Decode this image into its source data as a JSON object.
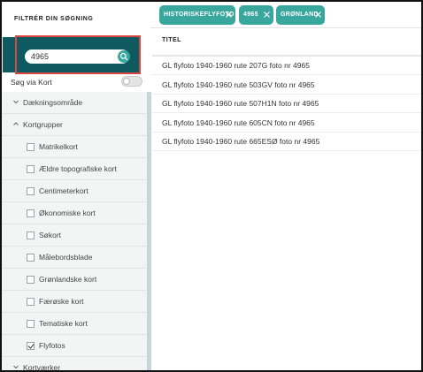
{
  "sidebar": {
    "heading": "FILTRÉR DIN SØGNING",
    "search": {
      "value": "4965"
    },
    "toggle_label": "Søg via Kort",
    "tree": [
      {
        "label": "Dækningsområde",
        "kind": "group",
        "expanded": false
      },
      {
        "label": "Kortgrupper",
        "kind": "group",
        "expanded": true
      },
      {
        "label": "Matrikelkort",
        "kind": "checkbox",
        "checked": false
      },
      {
        "label": "Ældre topografiske kort",
        "kind": "checkbox",
        "checked": false
      },
      {
        "label": "Centimeterkort",
        "kind": "checkbox",
        "checked": false
      },
      {
        "label": "Økonomiske kort",
        "kind": "checkbox",
        "checked": false
      },
      {
        "label": "Søkort",
        "kind": "checkbox",
        "checked": false
      },
      {
        "label": "Målebordsblade",
        "kind": "checkbox",
        "checked": false
      },
      {
        "label": "Grønlandske kort",
        "kind": "checkbox",
        "checked": false
      },
      {
        "label": "Færøske kort",
        "kind": "checkbox",
        "checked": false
      },
      {
        "label": "Tematiske kort",
        "kind": "checkbox",
        "checked": false
      },
      {
        "label": "Flyfotos",
        "kind": "checkbox",
        "checked": true
      },
      {
        "label": "Kortværker",
        "kind": "group",
        "expanded": false
      }
    ]
  },
  "chips": [
    {
      "label": "HISTORISKEFLYFOTO"
    },
    {
      "label": "4965"
    },
    {
      "label": "GRØNLAND"
    }
  ],
  "results": {
    "column_header": "TITEL",
    "rows": [
      "GL flyfoto 1940-1960 rute 207G foto nr 4965",
      "GL flyfoto 1940-1960 rute 503GV foto nr 4965",
      "GL flyfoto 1940-1960 rute 507H1N foto nr 4965",
      "GL flyfoto 1940-1960 rute 605CN foto nr 4965",
      "GL flyfoto 1940-1960 rute 665ESØ foto nr 4965"
    ]
  },
  "colors": {
    "search_panel": "#0f5a60",
    "accent": "#3aa79e",
    "highlight": "#d9473f"
  }
}
